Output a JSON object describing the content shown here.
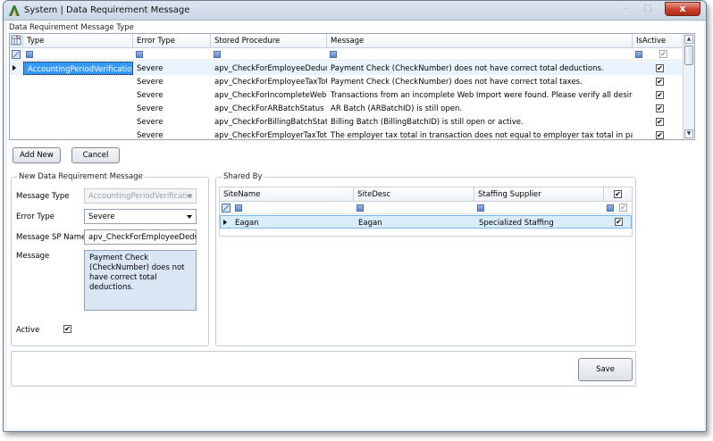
{
  "window": {
    "title": "System | Data Requirement Message",
    "close_label": "x",
    "min_label": "–",
    "max_label": "□"
  },
  "type_grid": {
    "group_label": "Data Requirement Message Type",
    "columns": [
      "Type",
      "Error Type",
      "Stored Procedure",
      "Message",
      "IsActive"
    ],
    "rows": [
      {
        "type": "AccountingPeriodVerification",
        "error_type": "Severe",
        "stored_procedure": "apv_CheckForEmployeeDeducti...",
        "message": "Payment Check (CheckNumber) does not have correct total deductions.",
        "is_active": "✔"
      },
      {
        "type": "",
        "error_type": "Severe",
        "stored_procedure": "apv_CheckForEmployeeTaxTotal",
        "message": "Payment Check (CheckNumber) does not have correct total taxes.",
        "is_active": "✔"
      },
      {
        "type": "",
        "error_type": "Severe",
        "stored_procedure": "apv_CheckForIncompleteWebTr...",
        "message": "Transactions from an incomplete Web Import were found.  Please verify all desired Web...",
        "is_active": "✔"
      },
      {
        "type": "",
        "error_type": "Severe",
        "stored_procedure": "apv_CheckForARBatchStatus",
        "message": "AR Batch (ARBatchID) is still open.",
        "is_active": "✔"
      },
      {
        "type": "",
        "error_type": "Severe",
        "stored_procedure": "apv_CheckForBillingBatchStatus",
        "message": "Billing Batch (BillingBatchID) is still open or active.",
        "is_active": "✔"
      },
      {
        "type": "",
        "error_type": "Severe",
        "stored_procedure": "apv_CheckForEmployerTaxTotal",
        "message": "The employer tax total in transaction does not equal to employer tax total in payment c...",
        "is_active": "✔"
      }
    ]
  },
  "buttons": {
    "add_new": "Add New",
    "cancel": "Cancel",
    "save": "Save"
  },
  "new_message": {
    "group_label": "New Data Requirement Message",
    "message_type_label": "Message Type",
    "message_type_value": "AccountingPeriodVerificatio",
    "error_type_label": "Error Type",
    "error_type_value": "Severe",
    "sp_name_label": "Message SP Name",
    "sp_name_value": "apv_CheckForEmployeeDeducti",
    "message_label": "Message",
    "message_value": "Payment Check (CheckNumber) does not have correct total deductions.",
    "active_label": "Active",
    "active_checked": "✔"
  },
  "shared_by": {
    "group_label": "Shared By",
    "columns": [
      "SiteName",
      "SiteDesc",
      "Staffing Supplier"
    ],
    "header_check": "✔",
    "rows": [
      {
        "site_name": "Eagan",
        "site_desc": "Eagan",
        "staffing_supplier": "Specialized Staffing",
        "checked": "✔"
      }
    ]
  },
  "colors": {
    "selection": "#3399ff",
    "filter_box": "#5a86cc",
    "row_highlight": "#d9ecfb"
  }
}
